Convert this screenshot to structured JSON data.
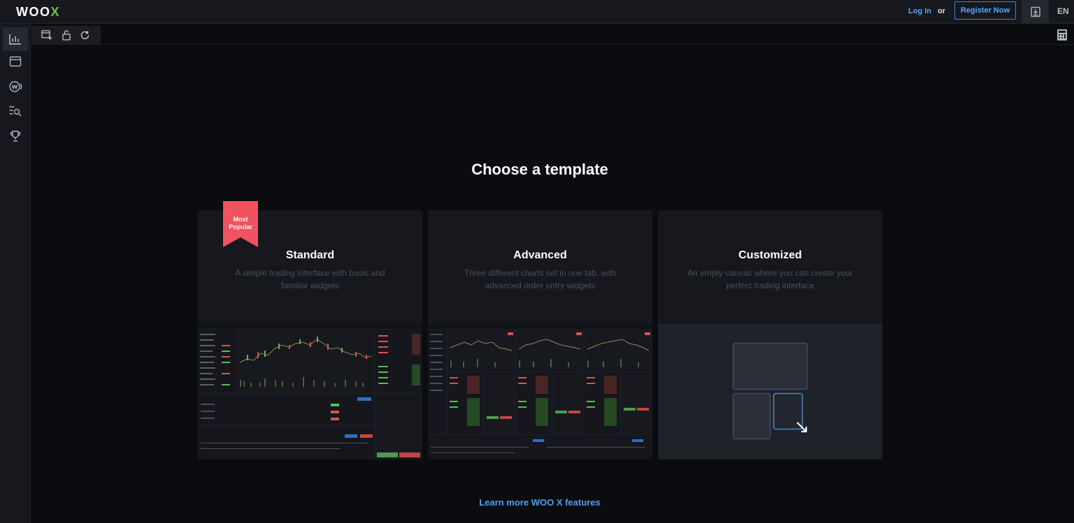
{
  "header": {
    "logo_main": "WOO",
    "logo_accent": "X",
    "login_label": "Log In",
    "or_label": "or",
    "register_label": "Register Now",
    "download_icon": "download-icon",
    "language": "EN"
  },
  "sidebar": {
    "items": [
      {
        "icon": "chart-icon",
        "active": true
      },
      {
        "icon": "window-icon",
        "active": false
      },
      {
        "icon": "woo-token-icon",
        "active": false
      },
      {
        "icon": "search-list-icon",
        "active": false
      },
      {
        "icon": "trophy-icon",
        "active": false
      }
    ]
  },
  "toolbar": {
    "icons": [
      "add-layout-icon",
      "unlock-icon",
      "refresh-icon"
    ],
    "right_icon": "calculator-icon"
  },
  "main": {
    "title": "Choose a template",
    "badge": "Most Popular",
    "templates": [
      {
        "title": "Standard",
        "description": "A simple trading interface with basic and familiar widgets"
      },
      {
        "title": "Advanced",
        "description": "Three different charts set in one tab, with advanced order entry widgets"
      },
      {
        "title": "Customized",
        "description": "An empty canvas where you can create your perfect trading interface"
      }
    ],
    "learn_more": "Learn more WOO X features"
  },
  "colors": {
    "background": "#0b0c0f",
    "panel": "#16181d",
    "accent_blue": "#4ea0f2",
    "badge_red": "#f0525f",
    "logo_green": "#6cc04a"
  }
}
